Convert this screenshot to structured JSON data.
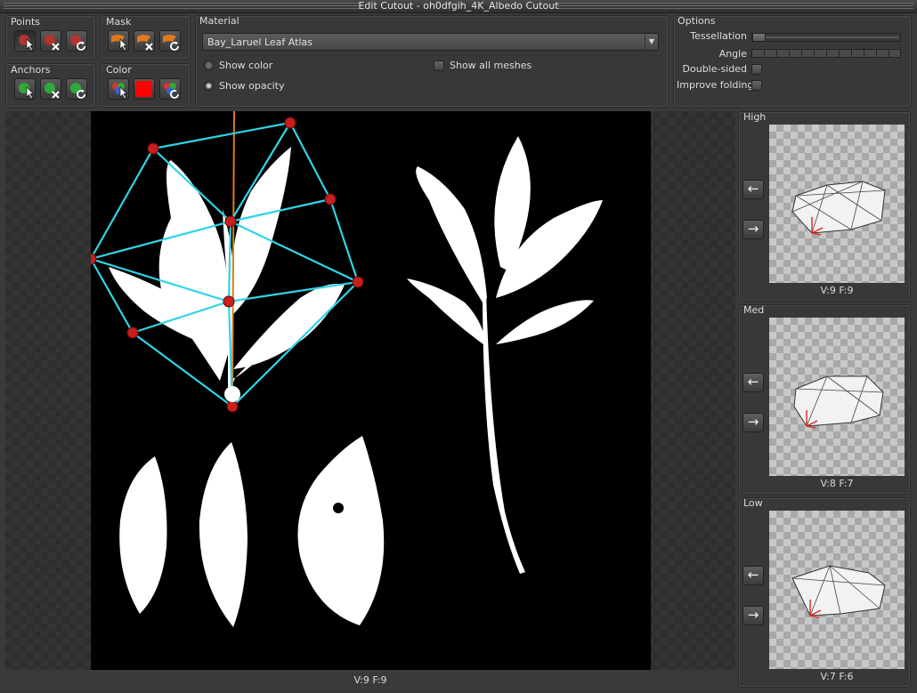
{
  "window": {
    "title": "Edit Cutout - oh0dfgih_4K_Albedo Cutout"
  },
  "points": {
    "label": "Points",
    "buttons": [
      "select-point",
      "delete-point",
      "reset-points"
    ]
  },
  "mask": {
    "label": "Mask",
    "buttons": [
      "select-mask",
      "delete-mask",
      "reset-mask"
    ]
  },
  "anchors": {
    "label": "Anchors",
    "buttons": [
      "select-anchor",
      "delete-anchor",
      "reset-anchors"
    ]
  },
  "color": {
    "label": "Color",
    "swatch": "#ff0000"
  },
  "material": {
    "label": "Material",
    "selected": "Bay_Laruel Leaf Atlas",
    "show_color_label": "Show color",
    "show_opacity_label": "Show opacity",
    "show_opacity_selected": true,
    "show_all_meshes_label": "Show all  meshes",
    "show_all_meshes_checked": false
  },
  "options": {
    "label": "Options",
    "tessellation_label": "Tessellation",
    "tessellation_value": 0,
    "angle_label": "Angle",
    "double_sided_label": "Double-sided",
    "double_sided_checked": false,
    "improve_folding_label": "Improve folding",
    "improve_folding_checked": false
  },
  "viewport": {
    "stats": "V:9  F:9"
  },
  "lods": [
    {
      "label": "High",
      "stats": "V:9  F:9"
    },
    {
      "label": "Med",
      "stats": "V:8  F:7"
    },
    {
      "label": "Low",
      "stats": "V:7  F:6"
    }
  ],
  "icons": {
    "prev": "arrow-left-icon",
    "next": "arrow-right-icon"
  },
  "colors": {
    "mesh_edge": "#2fd4e6",
    "vertex": "#c81e1e",
    "pivot_line": "#e07a1a",
    "anchor": "#ffffff"
  }
}
